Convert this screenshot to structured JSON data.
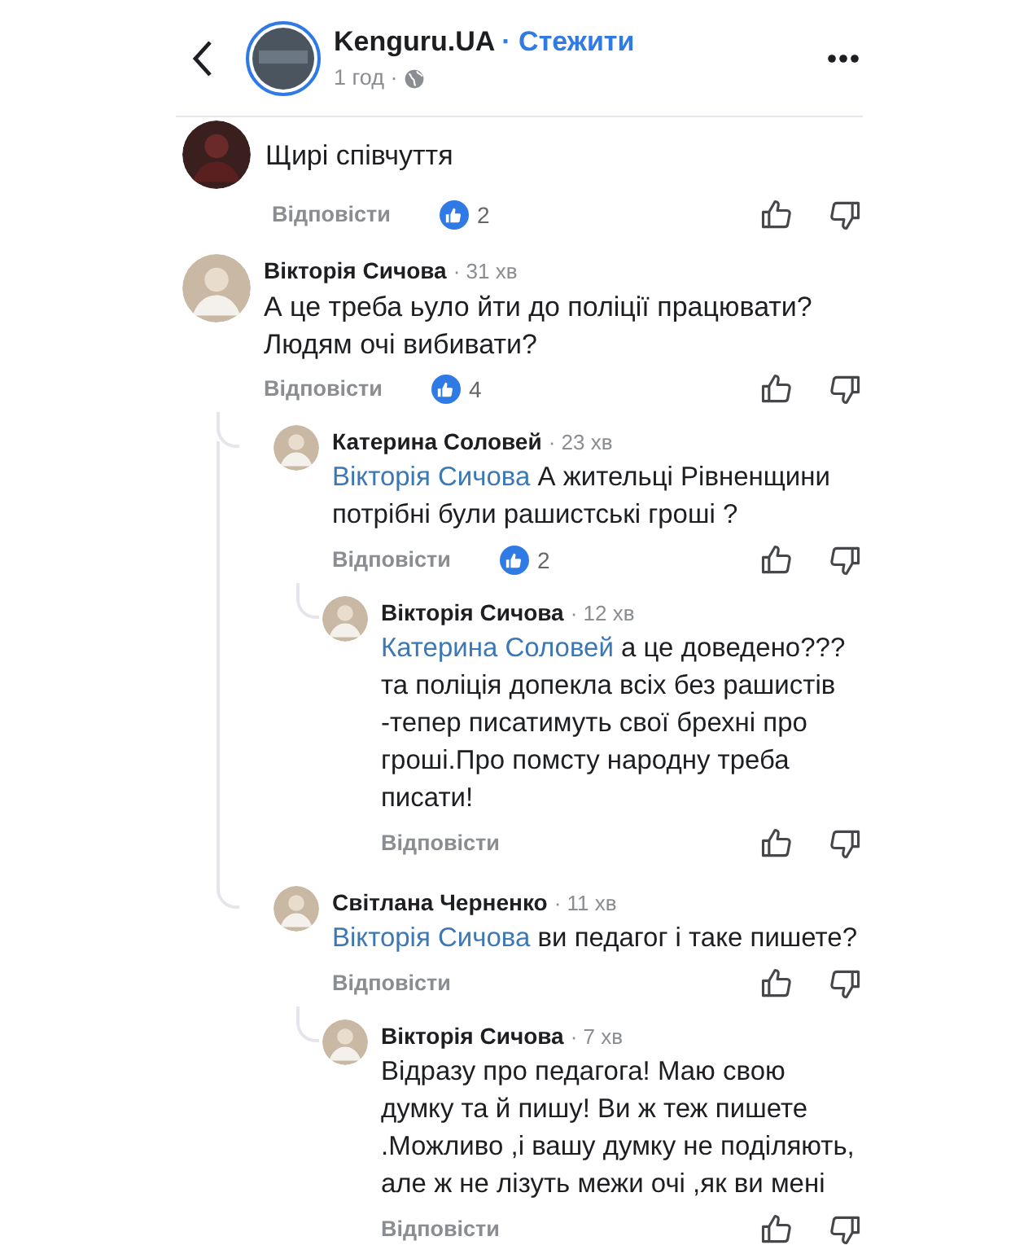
{
  "header": {
    "page_name": "Kenguru.UA",
    "follow": "· Стежити",
    "time": "1 год ·"
  },
  "comments": [
    {
      "kind": "partial",
      "text": "Щирі співчуття",
      "reply": "Відповісти",
      "likes": "2"
    },
    {
      "kind": "full",
      "author": "Вікторія Сичова",
      "time": "· 31 хв",
      "text": "А це треба ьуло йти до поліції працювати? Людям очі вибивати?",
      "reply": "Відповісти",
      "likes": "4",
      "children": [
        {
          "kind": "full",
          "author": "Катерина Соловей",
          "time": "· 23 хв",
          "mention": "Вікторія Сичова",
          "text": "А жительці Рівненщини потрібні були рашистські гроші ?",
          "reply": "Відповісти",
          "likes": "2",
          "children": [
            {
              "kind": "full",
              "author": "Вікторія Сичова",
              "time": "· 12 хв",
              "mention": "Катерина Соловей",
              "text": "а це доведено??? та поліція допекла всіх без рашистів -тепер писатимуть свої брехні про гроші.Про помсту народну треба писати!",
              "reply": "Відповісти"
            }
          ]
        },
        {
          "kind": "full",
          "author": "Світлана Черненко",
          "time": "· 11 хв",
          "mention": "Вікторія Сичова",
          "text": "ви педагог і таке пишете?",
          "reply": "Відповісти",
          "children": [
            {
              "kind": "full",
              "author": "Вікторія Сичова",
              "time": "· 7 хв",
              "text": "Відразу про педагога! Маю свою думку та й пишу! Ви ж теж пишете .Можливо ,і вашу думку не поділяють, але ж не лізуть межи очі ,як ви мені",
              "reply": "Відповісти"
            }
          ]
        }
      ]
    }
  ]
}
